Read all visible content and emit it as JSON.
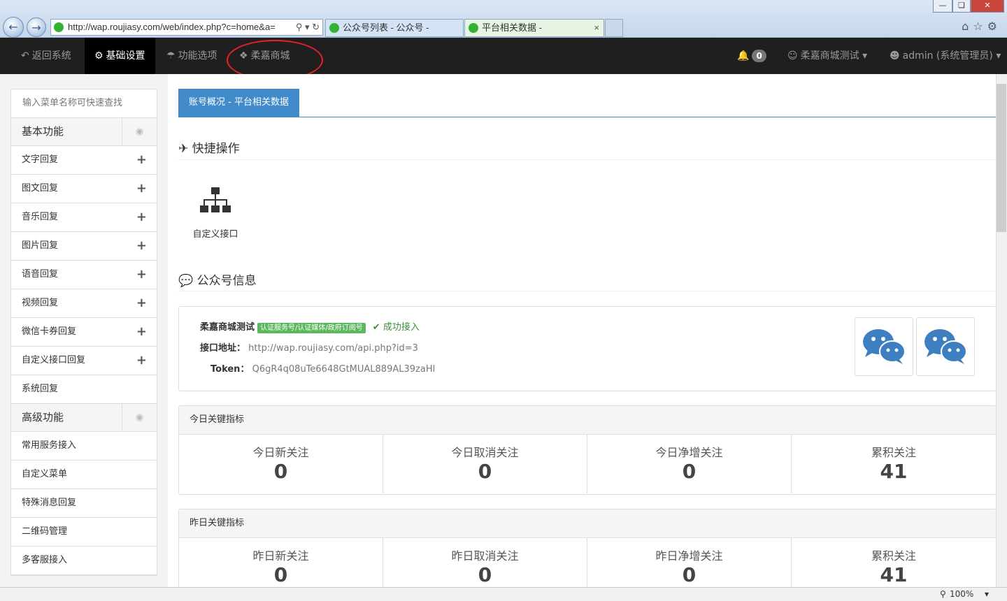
{
  "browser": {
    "url": "http://wap.roujiasy.com/web/index.php?c=home&a=",
    "tabs": [
      {
        "label": "公众号列表 - 公众号 -"
      },
      {
        "label": "平台相关数据 -"
      }
    ],
    "zoom": "100%"
  },
  "topnav": {
    "back": "返回系统",
    "basic_settings": "基础设置",
    "features": "功能选项",
    "store": "柔嘉商城",
    "notifications": "0",
    "account": "柔嘉商城测试",
    "user": "admin (系统管理员)"
  },
  "sidebar": {
    "search_placeholder": "输入菜单名称可快速查找",
    "basic": {
      "title": "基本功能",
      "items": [
        "文字回复",
        "图文回复",
        "音乐回复",
        "图片回复",
        "语音回复",
        "视频回复",
        "微信卡券回复",
        "自定义接口回复",
        "系统回复"
      ]
    },
    "advanced": {
      "title": "高级功能",
      "items": [
        "常用服务接入",
        "自定义菜单",
        "特殊消息回复",
        "二维码管理",
        "多客服接入"
      ]
    }
  },
  "main": {
    "tab": "账号概况 - 平台相关数据",
    "quick_title": "快捷操作",
    "quick_item": "自定义接口",
    "info_title": "公众号信息",
    "info": {
      "name": "柔嘉商城测试",
      "type_tag": "认证服务号/认证媒体/政府订阅号",
      "status": "成功接入",
      "api_label": "接口地址：",
      "api_url": "http://wap.roujiasy.com/api.php?id=3",
      "token_label": "Token：",
      "token": "Q6gR4q08uTe6648GtMUAL889AL39zaHl"
    },
    "today": {
      "title": "今日关键指标",
      "cells": [
        {
          "label": "今日新关注",
          "value": "0"
        },
        {
          "label": "今日取消关注",
          "value": "0"
        },
        {
          "label": "今日净增关注",
          "value": "0"
        },
        {
          "label": "累积关注",
          "value": "41"
        }
      ]
    },
    "yesterday": {
      "title": "昨日关键指标",
      "cells": [
        {
          "label": "昨日新关注",
          "value": "0"
        },
        {
          "label": "昨日取消关注",
          "value": "0"
        },
        {
          "label": "昨日净增关注",
          "value": "0"
        },
        {
          "label": "累积关注",
          "value": "41"
        }
      ]
    }
  },
  "colors": {
    "primary": "#428bca",
    "success": "#5cb85c",
    "nav": "#1f1f1f",
    "annotation": "#e8212a"
  }
}
